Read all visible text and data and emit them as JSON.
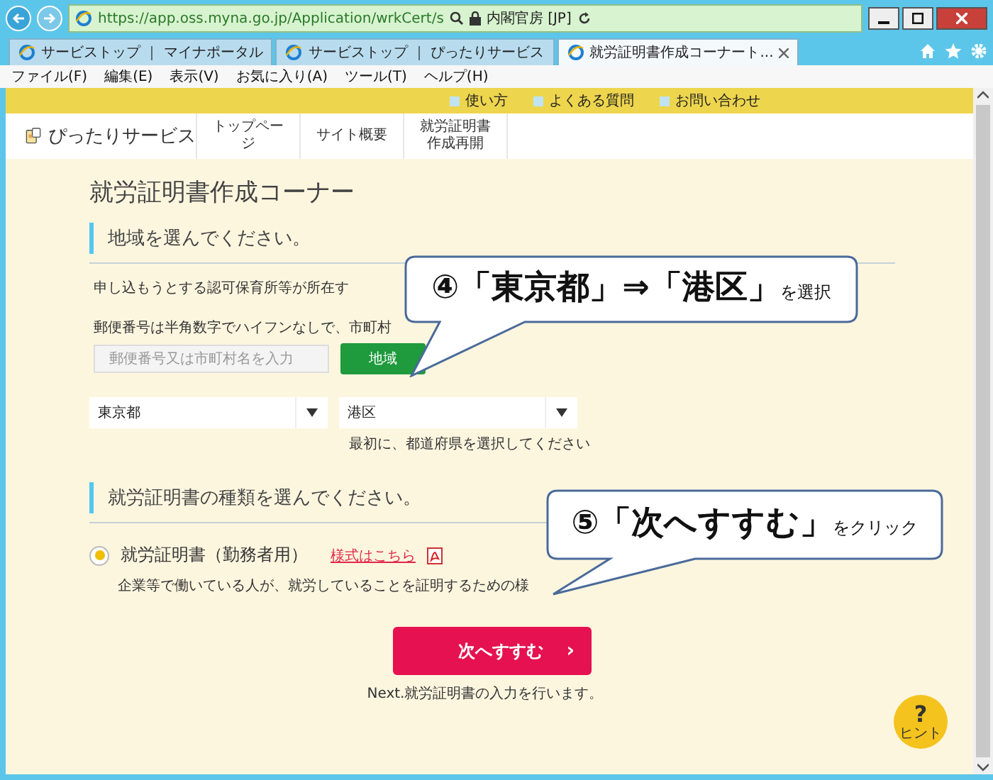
{
  "browser": {
    "address": "https://app.oss.myna.go.jp/Application/wrkCert/s",
    "site_identity": "内閣官房 [JP]",
    "tabs": [
      {
        "label": "サービストップ ｜ マイナポータル",
        "selected": false
      },
      {
        "label": "サービストップ ｜ ぴったりサービス",
        "selected": false
      },
      {
        "label": "就労証明書作成コーナート...",
        "selected": true
      }
    ],
    "menu": [
      "ファイル(F)",
      "編集(E)",
      "表示(V)",
      "お気に入り(A)",
      "ツール(T)",
      "ヘルプ(H)"
    ]
  },
  "top_links": [
    "使い方",
    "よくある質問",
    "お問い合わせ"
  ],
  "header": {
    "logo": "ぴったりサービス",
    "nav": [
      "トップページ",
      "サイト概要",
      "就労証明書作成再開"
    ]
  },
  "title": "就労証明書作成コーナー",
  "region": {
    "heading": "地域を選んでください。",
    "intro": "申し込もうとする認可保育所等が所在す",
    "postal_hint": "郵便番号は半角数字でハイフンなしで、市町村",
    "postal_placeholder": "郵便番号又は市町村名を入力",
    "search_button": "地域",
    "prefecture": "東京都",
    "city": "港区",
    "select_hint": "最初に、都道府県を選択してください"
  },
  "certificate": {
    "heading": "就労証明書の種類を選んでください。",
    "options": [
      {
        "label": "就労証明書（勤務者用）",
        "selected": true,
        "link": "様式はこちら",
        "description": "企業等で働いている人が、就労していることを証明するための様"
      }
    ]
  },
  "next_button": {
    "label": "次へすすむ",
    "chevron": "›",
    "note": "Next.就労証明書の入力を行います。"
  },
  "hint_button": {
    "mark": "?",
    "label": "ヒント"
  },
  "callouts": [
    {
      "text": "④「東京都」⇒「港区」",
      "suffix": "を選択"
    },
    {
      "text": "⑤「次へすすむ」",
      "suffix": "をクリック"
    }
  ]
}
